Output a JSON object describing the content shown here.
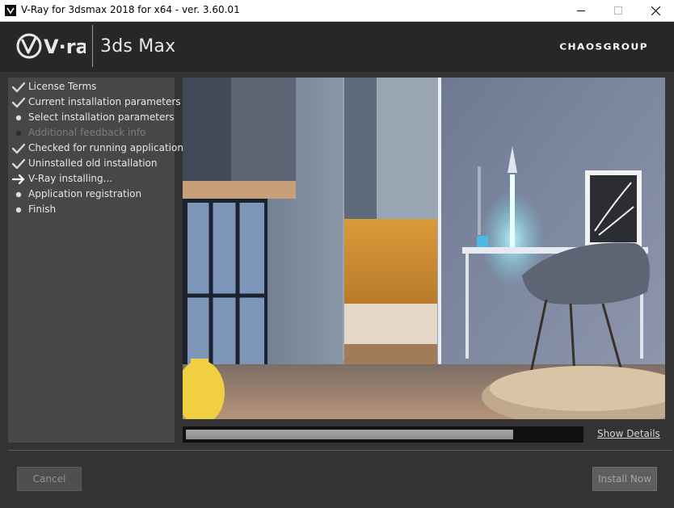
{
  "window": {
    "title": "V-Ray for 3dsmax 2018 for x64 - ver. 3.60.01",
    "minimize_icon": "minimize-icon",
    "maximize_icon": "maximize-icon",
    "close_icon": "close-icon"
  },
  "header": {
    "brand": "V·ray",
    "product": "3ds Max",
    "company": "CHAOSGROUP"
  },
  "steps": [
    {
      "label": "License Terms",
      "state": "done",
      "icon": "checkmark-icon"
    },
    {
      "label": "Current installation parameters",
      "state": "done",
      "icon": "checkmark-icon"
    },
    {
      "label": "Select installation parameters",
      "state": "pending",
      "icon": "bullet-icon"
    },
    {
      "label": "Additional feedback info",
      "state": "skipped",
      "icon": "bullet-icon"
    },
    {
      "label": "Checked for running applications",
      "state": "done",
      "icon": "checkmark-icon"
    },
    {
      "label": "Uninstalled old installation",
      "state": "done",
      "icon": "checkmark-icon"
    },
    {
      "label": "V-Ray installing...",
      "state": "current",
      "icon": "arrow-right-icon"
    },
    {
      "label": "Application registration",
      "state": "pending",
      "icon": "bullet-icon"
    },
    {
      "label": "Finish",
      "state": "pending",
      "icon": "bullet-icon"
    }
  ],
  "progress": {
    "value": 0.83
  },
  "links": {
    "show_details": "Show Details"
  },
  "buttons": {
    "cancel": "Cancel",
    "install_now": "Install Now"
  },
  "colors": {
    "panel": "#474747",
    "window_bg": "#333333",
    "header_bg": "#272727"
  }
}
